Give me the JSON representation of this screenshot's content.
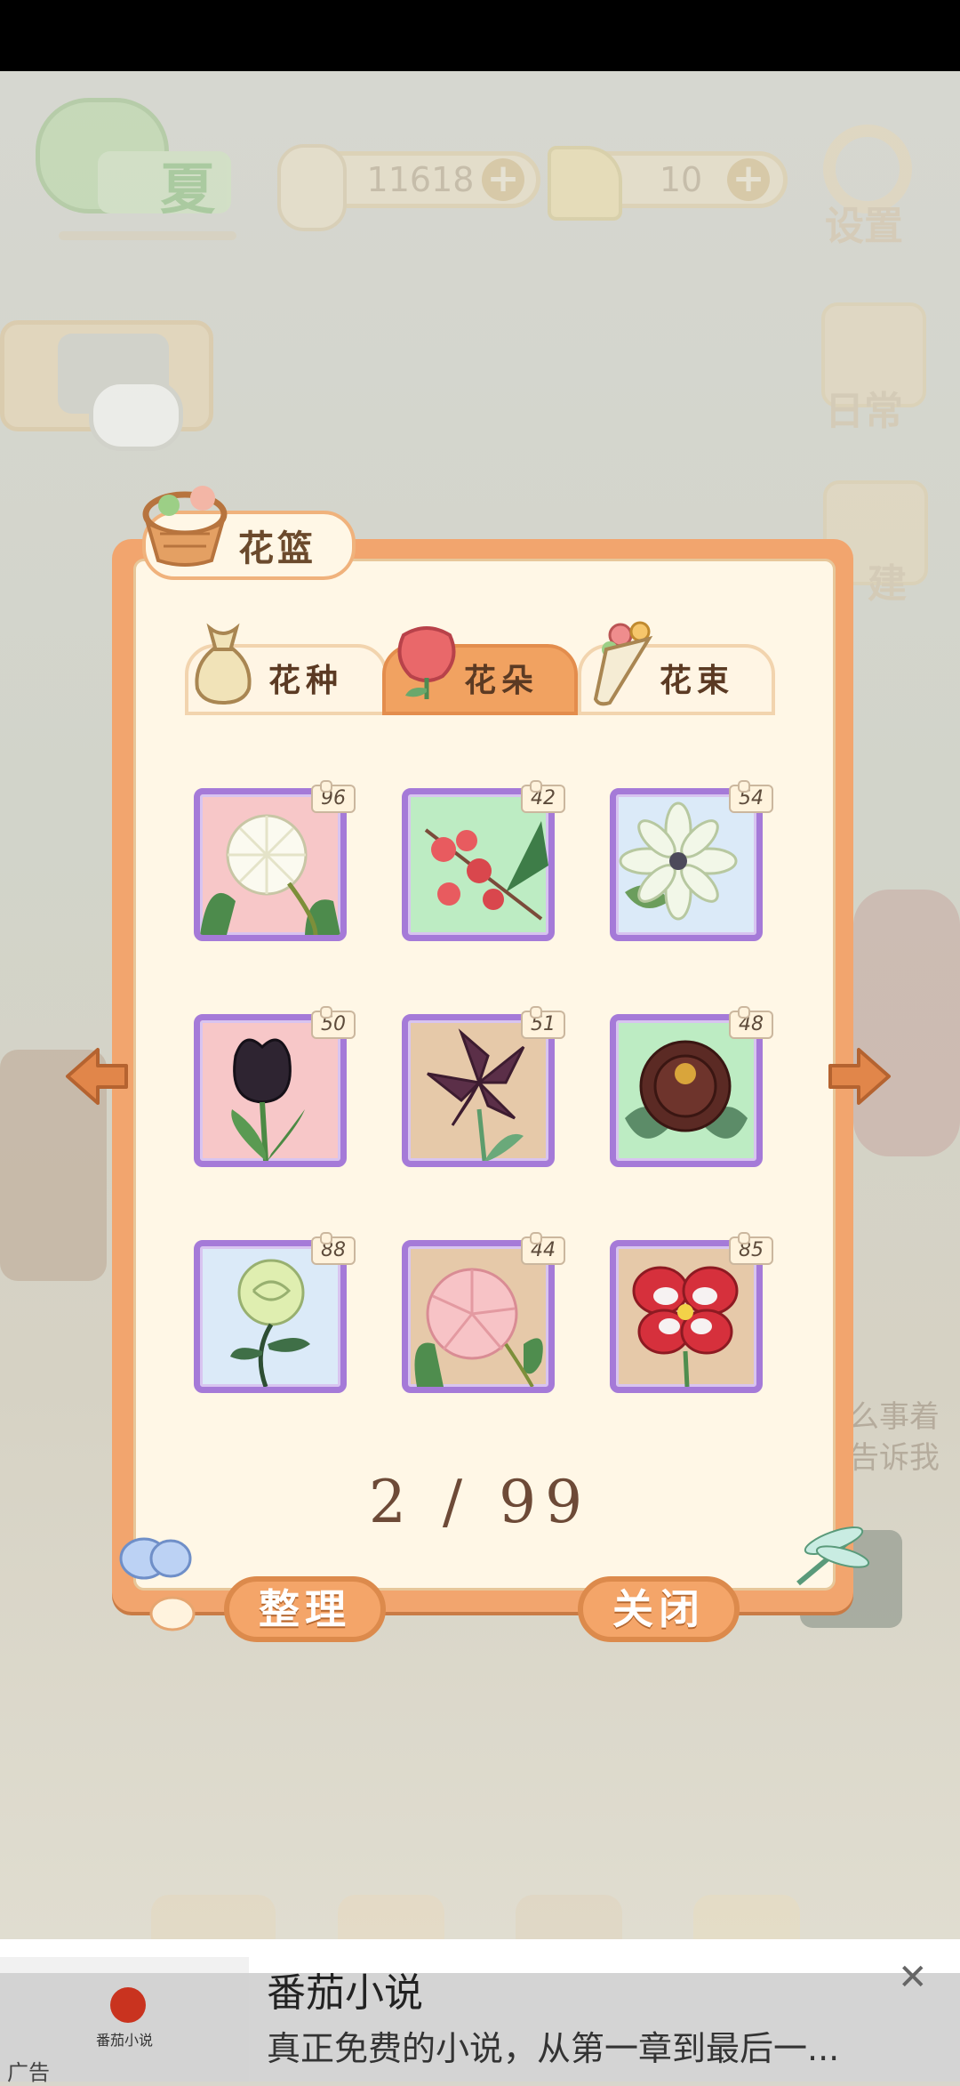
{
  "hud": {
    "season": "夏",
    "fish_count": "11618",
    "cheese_count": "10",
    "settings_label": "设置",
    "daily_label": "日常",
    "build_label": "建"
  },
  "background_hint": {
    "line1": "么事着",
    "line2": "告诉我"
  },
  "panel": {
    "title": "花篮",
    "tabs": [
      {
        "label": "花种",
        "active": false
      },
      {
        "label": "花朵",
        "active": true
      },
      {
        "label": "花束",
        "active": false
      }
    ],
    "items": [
      {
        "name": "white-morning-glory",
        "count": "96",
        "bg": "#f7c7c8"
      },
      {
        "name": "red-cluster-flower",
        "count": "42",
        "bg": "#bdecc3"
      },
      {
        "name": "white-dahlia",
        "count": "54",
        "bg": "#dbeaf8"
      },
      {
        "name": "black-tulip",
        "count": "50",
        "bg": "#f7c7c8"
      },
      {
        "name": "purple-lily",
        "count": "51",
        "bg": "#e6c9a9"
      },
      {
        "name": "dark-peony",
        "count": "48",
        "bg": "#bdecc3"
      },
      {
        "name": "green-rose",
        "count": "88",
        "bg": "#dbeaf8"
      },
      {
        "name": "pink-hibiscus",
        "count": "44",
        "bg": "#e6c9a9"
      },
      {
        "name": "red-white-pansy",
        "count": "85",
        "bg": "#e6c9a9"
      }
    ],
    "page_indicator": "2 / 99",
    "sort_button": "整理",
    "close_button": "关闭"
  },
  "ad": {
    "app_name": "番茄小说",
    "tagline": "真正免费的小说，从第一章到最后一...",
    "tag": "广告",
    "brand_small": "番茄小说"
  }
}
